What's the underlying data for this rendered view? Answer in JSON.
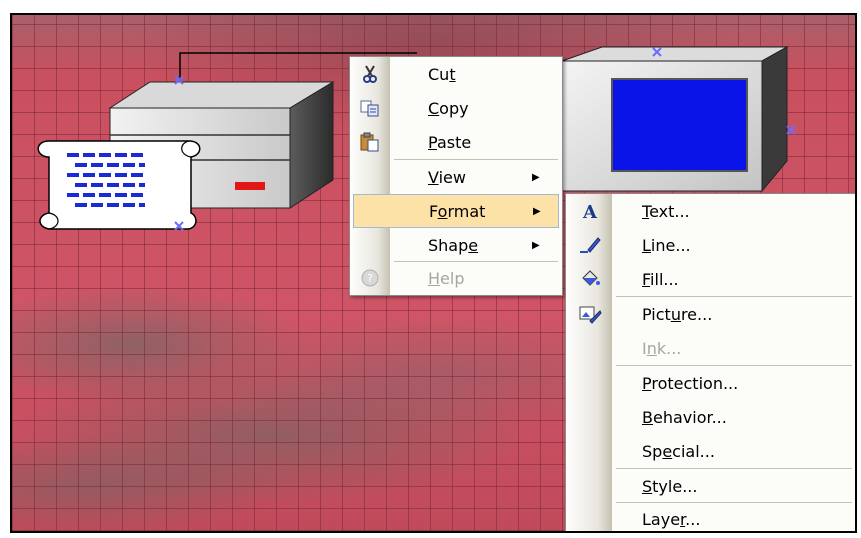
{
  "context_menu": {
    "items": [
      {
        "label": "Cut",
        "accel": "t",
        "icon": "scissors-icon"
      },
      {
        "label": "Copy",
        "accel": "C",
        "icon": "copy-icon"
      },
      {
        "label": "Paste",
        "accel": "P",
        "icon": "paste-icon"
      },
      {
        "label": "View",
        "accel": "V",
        "submenu": true
      },
      {
        "label": "Format",
        "accel": "o",
        "submenu": true,
        "highlighted": true
      },
      {
        "label": "Shape",
        "accel": "e",
        "submenu": true
      },
      {
        "label": "Help",
        "accel": "H",
        "disabled": true,
        "icon": "help-icon"
      }
    ]
  },
  "format_submenu": {
    "items": [
      {
        "label": "Text...",
        "accel": "T",
        "icon": "text-format-icon"
      },
      {
        "label": "Line...",
        "accel": "L",
        "icon": "line-format-icon"
      },
      {
        "label": "Fill...",
        "accel": "F",
        "icon": "fill-bucket-icon"
      },
      {
        "label": "Picture...",
        "accel": "u",
        "icon": "picture-format-icon"
      },
      {
        "label": "Ink...",
        "accel": "n",
        "disabled": true
      },
      {
        "label": "Protection...",
        "accel": "P"
      },
      {
        "label": "Behavior...",
        "accel": "B"
      },
      {
        "label": "Special...",
        "accel": "e"
      },
      {
        "label": "Style...",
        "accel": "S"
      },
      {
        "label": "Layer...",
        "accel": "r"
      }
    ]
  },
  "colors": {
    "menu_highlight": "#fde2a8",
    "canvas_background": "#c8505f",
    "monitor_screen": "#0a14e8",
    "document_lines": "#1a2ad6",
    "server_led": "#e01818"
  }
}
